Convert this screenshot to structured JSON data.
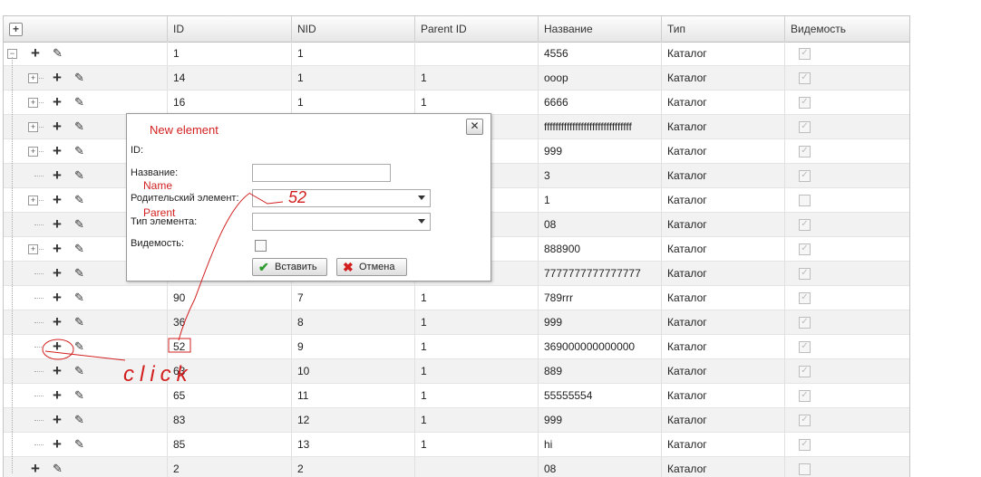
{
  "columns": [
    "ID",
    "NID",
    "Parent ID",
    "Название",
    "Тип",
    "Видемость"
  ],
  "rows": [
    {
      "id": "1",
      "nid": "1",
      "pid": "",
      "name": "4556",
      "type": "Каталог",
      "visible": true
    },
    {
      "id": "14",
      "nid": "1",
      "pid": "1",
      "name": "ooop",
      "type": "Каталог",
      "visible": true
    },
    {
      "id": "16",
      "nid": "1",
      "pid": "1",
      "name": "6666",
      "type": "Каталог",
      "visible": true
    },
    {
      "id": "",
      "nid": "",
      "pid": "",
      "name": "fffffffffffffffffffffffffffffff",
      "type": "Каталог",
      "visible": true
    },
    {
      "id": "",
      "nid": "",
      "pid": "",
      "name": "999",
      "type": "Каталог",
      "visible": true
    },
    {
      "id": "",
      "nid": "",
      "pid": "",
      "name": "3",
      "type": "Каталог",
      "visible": true
    },
    {
      "id": "",
      "nid": "",
      "pid": "",
      "name": "1",
      "type": "Каталог",
      "visible": false
    },
    {
      "id": "",
      "nid": "",
      "pid": "",
      "name": "08",
      "type": "Каталог",
      "visible": true
    },
    {
      "id": "",
      "nid": "",
      "pid": "",
      "name": "888900",
      "type": "Каталог",
      "visible": true
    },
    {
      "id": "",
      "nid": "",
      "pid": "",
      "name": "7777777777777777",
      "type": "Каталог",
      "visible": true
    },
    {
      "id": "90",
      "nid": "7",
      "pid": "1",
      "name": "789rrr",
      "type": "Каталог",
      "visible": true
    },
    {
      "id": "36",
      "nid": "8",
      "pid": "1",
      "name": "999",
      "type": "Каталог",
      "visible": true
    },
    {
      "id": "52",
      "nid": "9",
      "pid": "1",
      "name": "369000000000000",
      "type": "Каталог",
      "visible": true
    },
    {
      "id": "63",
      "nid": "10",
      "pid": "1",
      "name": "889",
      "type": "Каталог",
      "visible": true
    },
    {
      "id": "65",
      "nid": "11",
      "pid": "1",
      "name": "55555554",
      "type": "Каталог",
      "visible": true
    },
    {
      "id": "83",
      "nid": "12",
      "pid": "1",
      "name": "999",
      "type": "Каталог",
      "visible": true
    },
    {
      "id": "85",
      "nid": "13",
      "pid": "1",
      "name": "hi",
      "type": "Каталог",
      "visible": true
    },
    {
      "id": "2",
      "nid": "2",
      "pid": "",
      "name": "08",
      "type": "Каталог",
      "visible": false
    }
  ],
  "dialog": {
    "title": "New element",
    "close": "✕",
    "id_label": "ID:",
    "name_label": "Название:",
    "parent_label": "Родительский элемент:",
    "type_label": "Тип элемента:",
    "visible_label": "Видемость:",
    "insert_label": "Вставить",
    "cancel_label": "Отмена"
  },
  "annotations": {
    "name": "Name",
    "parent": "Parent",
    "parent_value": "52",
    "click": "click"
  }
}
